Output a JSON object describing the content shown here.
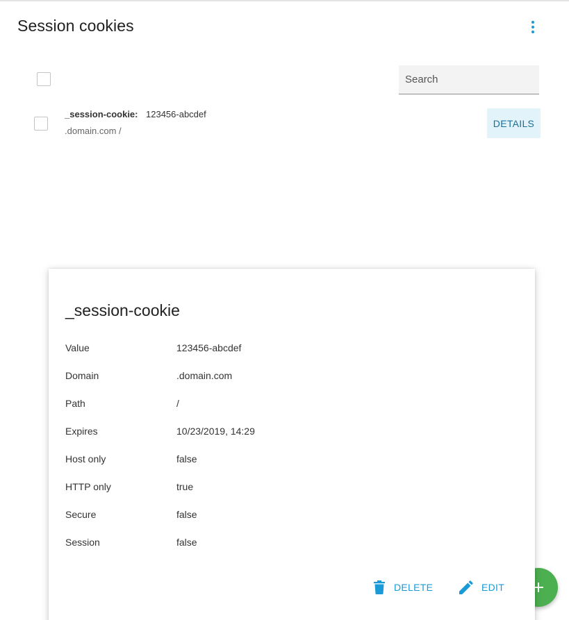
{
  "header": {
    "title": "Session cookies",
    "menu_icon": "more-vert-icon"
  },
  "toolbar": {
    "search_placeholder": "Search",
    "search_value": ""
  },
  "cookies": [
    {
      "name": "_session-cookie:",
      "value": "123456-abcdef",
      "location": ".domain.com /",
      "details_label": "DETAILS"
    }
  ],
  "dialog": {
    "title": "_session-cookie",
    "properties": [
      {
        "label": "Value",
        "value": "123456-abcdef"
      },
      {
        "label": "Domain",
        "value": ".domain.com"
      },
      {
        "label": "Path",
        "value": "/"
      },
      {
        "label": "Expires",
        "value": "10/23/2019, 14:29"
      },
      {
        "label": "Host only",
        "value": "false"
      },
      {
        "label": "HTTP only",
        "value": "true"
      },
      {
        "label": "Secure",
        "value": "false"
      },
      {
        "label": "Session",
        "value": "false"
      }
    ],
    "actions": {
      "delete_label": "DELETE",
      "delete_icon": "trash-icon",
      "edit_label": "EDIT",
      "edit_icon": "pencil-icon"
    }
  },
  "fab": {
    "icon": "plus-icon"
  },
  "colors": {
    "accent": "#1a9ad6",
    "fab": "#4caf50",
    "details_bg": "#e3f3fa"
  }
}
